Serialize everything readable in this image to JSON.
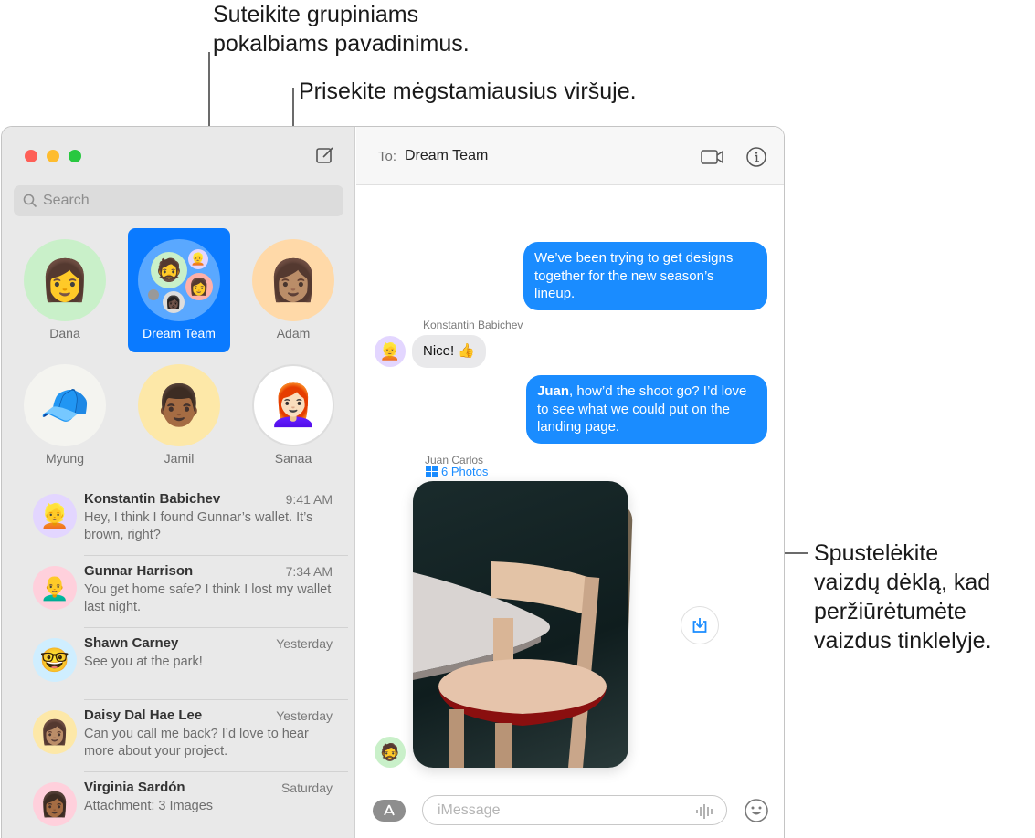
{
  "callouts": {
    "group_names": [
      "Suteikite grupiniams",
      "pokalbiams pavadinimus."
    ],
    "pin_favorites": "Prisekite mėgstamiausius viršuje.",
    "photo_stack": [
      "Spustelėkite",
      "vaizdų dėklą, kad",
      "peržiūrėtumėte",
      "vaizdus tinklelyje."
    ]
  },
  "sidebar": {
    "search_placeholder": "Search",
    "pinned": [
      {
        "name": "Dana",
        "icon": "memoji-dana",
        "bg": "#c9f0c9"
      },
      {
        "name": "Dream Team",
        "icon": "group-avatar",
        "bg": "#5aa8ff",
        "selected": true
      },
      {
        "name": "Adam",
        "icon": "memoji-adam",
        "bg": "#ffd9a8"
      },
      {
        "name": "Myung",
        "icon": "photo-myung",
        "bg": "#f4f4f0"
      },
      {
        "name": "Jamil",
        "icon": "memoji-jamil",
        "bg": "#fde8a8"
      },
      {
        "name": "Sanaa",
        "icon": "photo-sanaa",
        "bg": "#ffffff"
      }
    ],
    "conversations": [
      {
        "name": "Konstantin Babichev",
        "time": "9:41 AM",
        "preview": "Hey, I think I found Gunnar’s wallet. It’s brown, right?",
        "bg": "#e3d6ff"
      },
      {
        "name": "Gunnar Harrison",
        "time": "7:34 AM",
        "preview": "You get home safe? I think I lost my wallet last night.",
        "bg": "#ffd0dc"
      },
      {
        "name": "Shawn Carney",
        "time": "Yesterday",
        "preview": "See you at the park!",
        "bg": "#cfeeff"
      },
      {
        "name": "Daisy Dal Hae Lee",
        "time": "Yesterday",
        "preview": "Can you call me back? I’d love to hear more about your project.",
        "bg": "#fde8a8"
      },
      {
        "name": "Virginia Sardón",
        "time": "Saturday",
        "preview": "Attachment: 3 Images",
        "bg": "#ffd0dc"
      }
    ]
  },
  "chat": {
    "to_label": "To:",
    "to_value": "Dream Team",
    "messages": {
      "m1": "We’ve been trying to get designs together for the new season’s lineup.",
      "m2_sender": "Konstantin Babichev",
      "m2": "Nice! 👍",
      "m3_bold": "Juan",
      "m3_rest": ", how’d the shoot go? I’d love to see what we could put on the landing page.",
      "m4_sender": "Juan Carlos",
      "m4_photos": "6 Photos"
    },
    "composer_placeholder": "iMessage"
  },
  "colors": {
    "accent": "#0a7aff",
    "bubble_out": "#1a8cff",
    "bubble_in": "#e9e9eb"
  }
}
